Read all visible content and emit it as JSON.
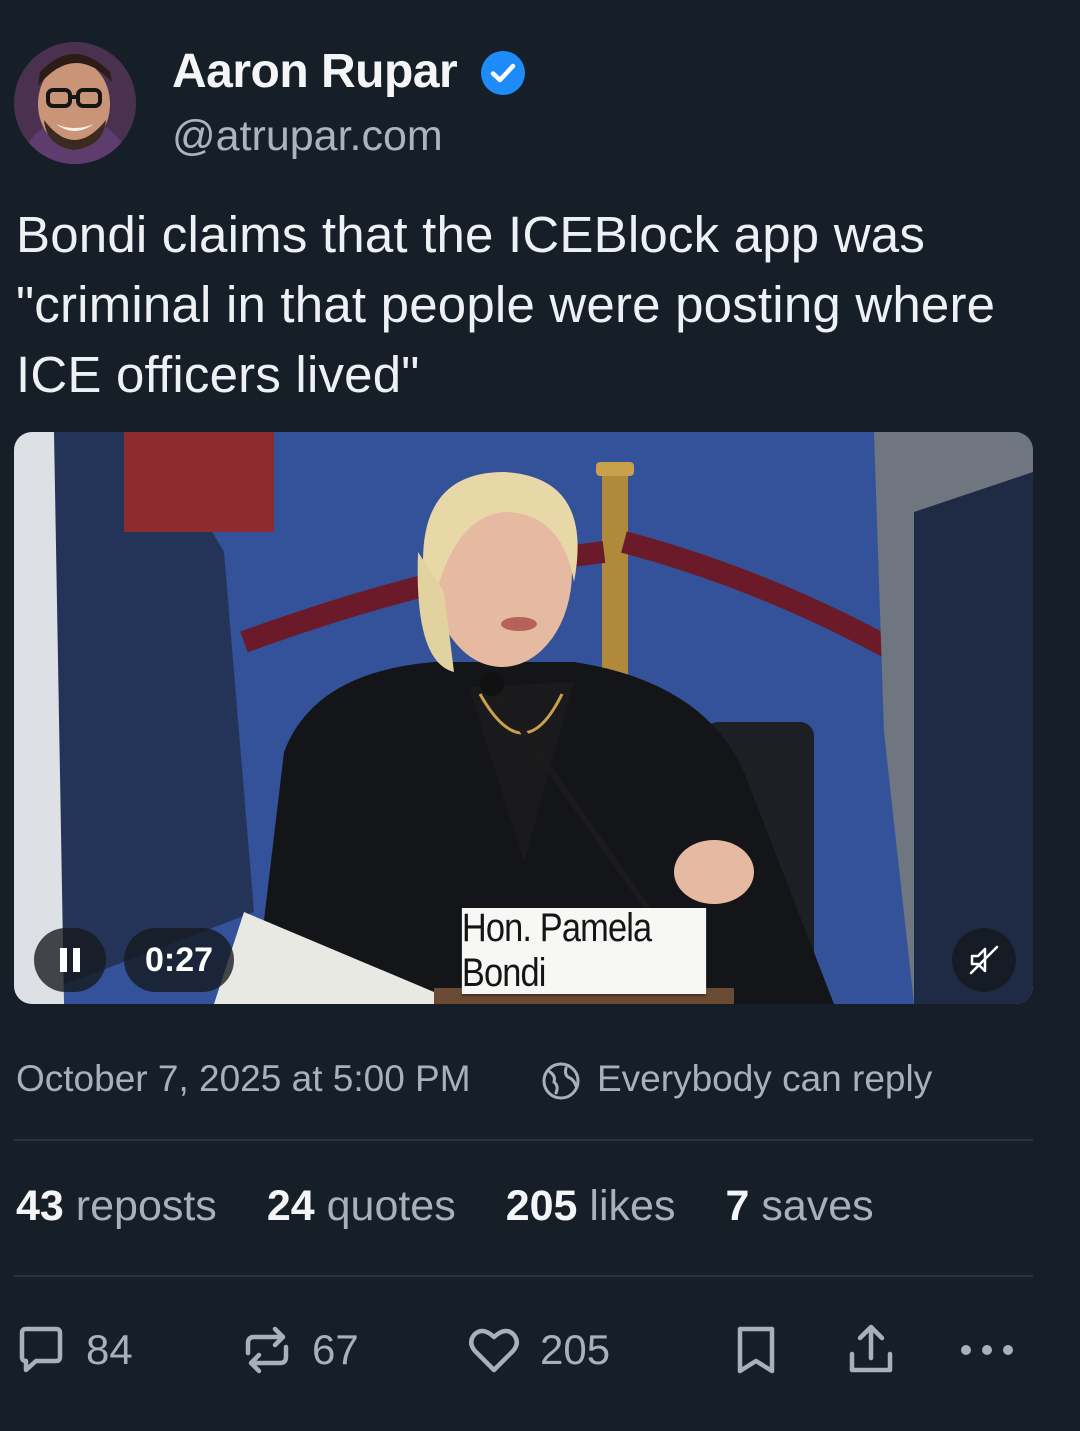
{
  "author": {
    "name": "Aaron Rupar",
    "handle": "@atrupar.com",
    "verified": true
  },
  "post": {
    "text": "Bondi claims that the ICEBlock app was \"criminal in that people were posting where ICE officers lived\"",
    "date": "October 7, 2025 at 5:00 PM",
    "reply_setting": "Everybody can reply"
  },
  "video": {
    "timestamp": "0:27",
    "nameplate": "Hon. Pamela Bondi",
    "playing": true,
    "muted": true
  },
  "stats": {
    "reposts_count": "43",
    "reposts_label": "reposts",
    "quotes_count": "24",
    "quotes_label": "quotes",
    "likes_count": "205",
    "likes_label": "likes",
    "saves_count": "7",
    "saves_label": "saves"
  },
  "actions": {
    "replies": "84",
    "reposts": "67",
    "likes": "205"
  },
  "colors": {
    "background": "#161e27",
    "secondary_text": "#a7b0bb",
    "verified_badge": "#1d8cf8"
  },
  "icons": [
    "verified-badge-icon",
    "pause-icon",
    "mute-icon",
    "globe-icon",
    "reply-icon",
    "repost-icon",
    "like-icon",
    "bookmark-icon",
    "share-icon",
    "more-icon"
  ]
}
